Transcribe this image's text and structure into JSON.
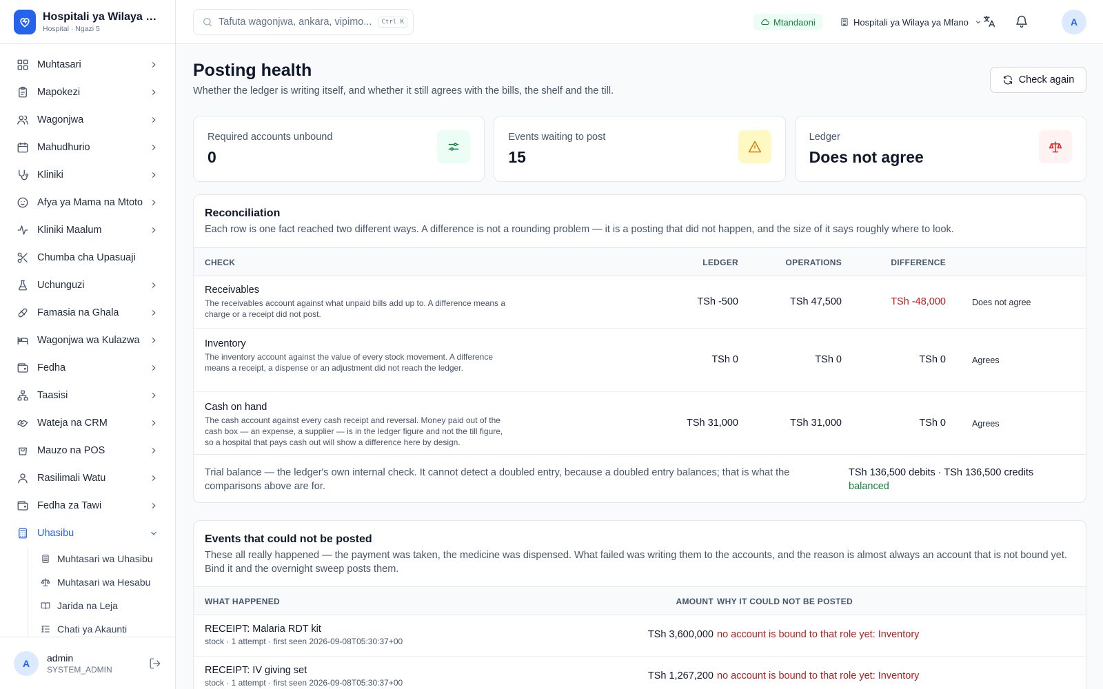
{
  "brand": {
    "title": "Hospitali ya Wilaya ya Mfano",
    "subtitle": "Hospital · Ngazi 5"
  },
  "sidebar": {
    "items": [
      {
        "label": "Muhtasari"
      },
      {
        "label": "Mapokezi"
      },
      {
        "label": "Wagonjwa"
      },
      {
        "label": "Mahudhurio"
      },
      {
        "label": "Kliniki"
      },
      {
        "label": "Afya ya Mama na Mtoto"
      },
      {
        "label": "Kliniki Maalum"
      },
      {
        "label": "Chumba cha Upasuaji"
      },
      {
        "label": "Uchunguzi"
      },
      {
        "label": "Famasia na Ghala"
      },
      {
        "label": "Wagonjwa wa Kulazwa"
      },
      {
        "label": "Fedha"
      },
      {
        "label": "Taasisi"
      },
      {
        "label": "Wateja na CRM"
      },
      {
        "label": "Mauzo na POS"
      },
      {
        "label": "Rasilimali Watu"
      },
      {
        "label": "Fedha za Tawi"
      },
      {
        "label": "Uhasibu"
      }
    ],
    "subitems": [
      {
        "label": "Muhtasari wa Uhasibu"
      },
      {
        "label": "Muhtasari wa Hesabu"
      },
      {
        "label": "Jarida na Leja"
      },
      {
        "label": "Chati ya Akaunti"
      }
    ]
  },
  "user": {
    "initial": "A",
    "name": "admin",
    "role": "SYSTEM_ADMIN"
  },
  "topbar": {
    "search_placeholder": "Tafuta wagonjwa, ankara, vipimo...",
    "shortcut": "Ctrl K",
    "status": "Mtandaoni",
    "facility": "Hospitali ya Wilaya ya Mfano",
    "avatar_initial": "A"
  },
  "colors": {
    "accent": "#2563eb",
    "success": "#15803d",
    "danger": "#b91c1c",
    "warning": "#d97706"
  },
  "page": {
    "title": "Posting health",
    "subtitle": "Whether the ledger is writing itself, and whether it still agrees with the bills, the shelf and the till.",
    "check_button": "Check again"
  },
  "stats": [
    {
      "label": "Required accounts unbound",
      "value": "0",
      "icon": "sliders-icon"
    },
    {
      "label": "Events waiting to post",
      "value": "15",
      "icon": "warning-icon"
    },
    {
      "label": "Ledger",
      "value": "Does not agree",
      "icon": "scale-icon"
    }
  ],
  "reconciliation": {
    "title": "Reconciliation",
    "description": "Each row is one fact reached two different ways. A difference is not a rounding problem — it is a posting that did not happen, and the size of it says roughly where to look.",
    "columns": {
      "check": "CHECK",
      "ledger": "LEDGER",
      "operations": "OPERATIONS",
      "difference": "DIFFERENCE"
    },
    "rows": [
      {
        "title": "Receivables",
        "desc": "The receivables account against what unpaid bills add up to. A difference means a charge or a receipt did not post.",
        "ledger": "TSh -500",
        "operations": "TSh 47,500",
        "difference": "TSh -48,000",
        "status": "Does not agree"
      },
      {
        "title": "Inventory",
        "desc": "The inventory account against the value of every stock movement. A difference means a receipt, a dispense or an adjustment did not reach the ledger.",
        "ledger": "TSh 0",
        "operations": "TSh 0",
        "difference": "TSh 0",
        "status": "Agrees"
      },
      {
        "title": "Cash on hand",
        "desc": "The cash account against every cash receipt and reversal. Money paid out of the cash box — an expense, a supplier — is in the ledger figure and not the till figure, so a hospital that pays cash out will show a difference here by design.",
        "ledger": "TSh 31,000",
        "operations": "TSh 31,000",
        "difference": "TSh 0",
        "status": "Agrees"
      }
    ],
    "trial": {
      "text": "Trial balance — the ledger's own internal check. It cannot detect a doubled entry, because a doubled entry balances; that is what the comparisons above are for.",
      "totals": "TSh 136,500 debits · TSh 136,500 credits",
      "state": "balanced"
    }
  },
  "failed": {
    "title": "Events that could not be posted",
    "description": "These all really happened — the payment was taken, the medicine was dispensed. What failed was writing them to the accounts, and the reason is almost always an account that is not bound yet. Bind it and the overnight sweep posts them.",
    "columns": {
      "what": "WHAT HAPPENED",
      "amount": "AMOUNT",
      "why": "WHY IT COULD NOT BE POSTED"
    },
    "rows": [
      {
        "title": "RECEIPT: Malaria RDT kit",
        "meta": "stock · 1 attempt · first seen 2026-09-08T05:30:37+00",
        "amount": "TSh 3,600,000",
        "reason": "no account is bound to that role yet: Inventory"
      },
      {
        "title": "RECEIPT: IV giving set",
        "meta": "stock · 1 attempt · first seen 2026-09-08T05:30:37+00",
        "amount": "TSh 1,267,200",
        "reason": "no account is bound to that role yet: Inventory"
      }
    ]
  }
}
